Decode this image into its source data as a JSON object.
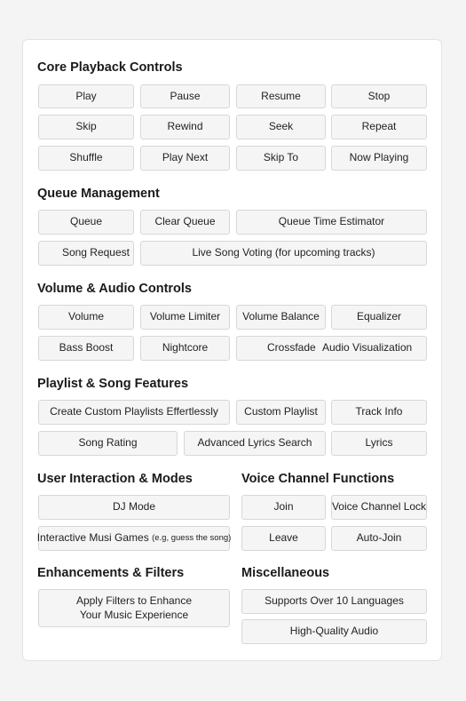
{
  "sections": {
    "core": {
      "title": "Core Playback Controls",
      "buttons": [
        "Play",
        "Pause",
        "Resume",
        "Stop",
        "Skip",
        "Rewind",
        "Seek",
        "Repeat",
        "Shuffle",
        "Play Next",
        "Skip To",
        "Now Playing"
      ]
    },
    "queue": {
      "title": "Queue Management",
      "buttons": [
        "Queue",
        "Clear Queue",
        "Queue Time Estimator",
        "Song Request",
        "Live Song Voting (for upcoming tracks)"
      ]
    },
    "volume": {
      "title": "Volume & Audio Controls",
      "buttons": [
        "Volume",
        "Volume Limiter",
        "Volume Balance",
        "Equalizer",
        "Bass Boost",
        "Nightcore",
        "Crossfade",
        "Audio Visualization"
      ]
    },
    "playlist": {
      "title": "Playlist & Song Features",
      "buttons": [
        "Create Custom Playlists Effertlessly",
        "Custom Playlist",
        "Track Info",
        "Song Rating",
        "Advanced Lyrics Search",
        "Lyrics"
      ]
    },
    "user": {
      "title": "User Interaction & Modes",
      "dj_mode": "DJ Mode",
      "games_main": "Interactive Musi Games",
      "games_note": "(e.g, guess the song)"
    },
    "voice": {
      "title": "Voice Channel Functions",
      "buttons": [
        "Join",
        "Voice Channel Lock",
        "Leave",
        "Auto-Join"
      ]
    },
    "enhance": {
      "title": "Enhancements & Filters",
      "line1": "Apply Filters to Enhance",
      "line2": "Your Music Experience"
    },
    "misc": {
      "title": "Miscellaneous",
      "buttons": [
        "Supports Over 10 Languages",
        "High-Quality Audio"
      ]
    }
  }
}
